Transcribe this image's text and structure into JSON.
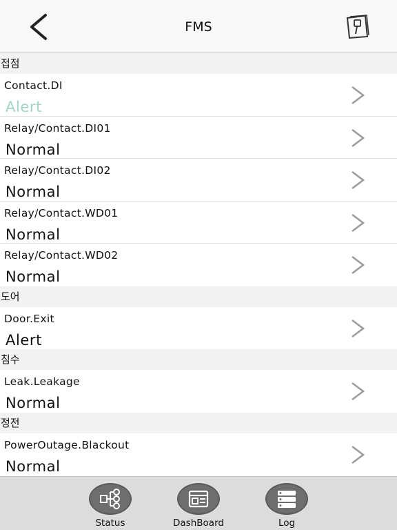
{
  "header": {
    "title": "FMS",
    "back_icon": "chevron-left-icon",
    "door_icon": "door-icon"
  },
  "sections": [
    {
      "title": "접점",
      "rows": [
        {
          "label": "Contact.DI",
          "status": "Alert",
          "status_color": "#9fd6c8"
        },
        {
          "label": "Relay/Contact.DI01",
          "status": "Normal",
          "status_color": "#111111"
        },
        {
          "label": "Relay/Contact.DI02",
          "status": "Normal",
          "status_color": "#111111"
        },
        {
          "label": "Relay/Contact.WD01",
          "status": "Normal",
          "status_color": "#111111"
        },
        {
          "label": "Relay/Contact.WD02",
          "status": "Normal",
          "status_color": "#111111"
        }
      ]
    },
    {
      "title": "도어",
      "rows": [
        {
          "label": "Door.Exit",
          "status": "Alert",
          "status_color": "#111111"
        }
      ]
    },
    {
      "title": "침수",
      "rows": [
        {
          "label": "Leak.Leakage",
          "status": "Normal",
          "status_color": "#111111"
        }
      ]
    },
    {
      "title": "정전",
      "rows": [
        {
          "label": "PowerOutage.Blackout",
          "status": "Normal",
          "status_color": "#111111"
        }
      ]
    }
  ],
  "tabbar": {
    "tabs": [
      {
        "label": "Status",
        "icon": "hierarchy-icon"
      },
      {
        "label": "DashBoard",
        "icon": "dashboard-icon"
      },
      {
        "label": "Log",
        "icon": "list-icon"
      }
    ]
  },
  "colors": {
    "alert_accent": "#9fd6c8",
    "tab_icon_bg": "#6e6e6e",
    "tabbar_bg": "#dcdcdc"
  }
}
